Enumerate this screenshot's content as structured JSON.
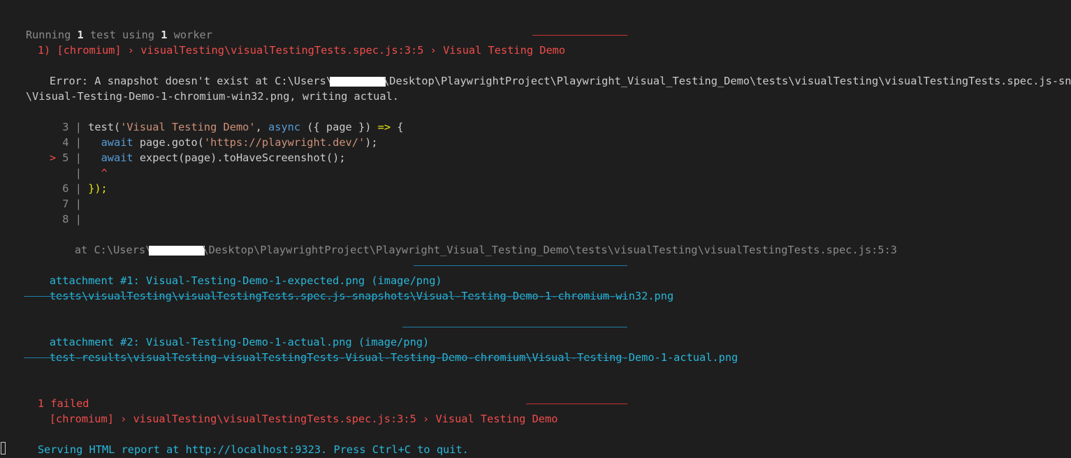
{
  "run": {
    "prefix": "Running ",
    "count1": "1",
    "mid": " test using ",
    "count2": "1",
    "suffix": " worker"
  },
  "test_header": {
    "index": "1) ",
    "browser": "[chromium]",
    "arrow1": " › ",
    "file": "visualTesting\\visualTestingTests.spec.js:3:5",
    "arrow2": " › ",
    "title": "Visual Testing Demo"
  },
  "error": {
    "line1_start": "Error: A snapshot doesn't exist at C:\\Users\\",
    "line1_end": "\\Desktop\\PlaywrightProject\\Playwright_Visual_Testing_Demo\\tests\\visualTesting\\visualTestingTests.spec.js-snapshots",
    "line2": "\\Visual-Testing-Demo-1-chromium-win32.png, writing actual."
  },
  "code": {
    "lines": [
      {
        "marker": "  ",
        "num": "3",
        "parts": {
          "a": "test(",
          "s": "'Visual Testing Demo'",
          "b": ", ",
          "k": "async",
          "c": " ({ page }) ",
          "y": "=>",
          "d": " {"
        }
      },
      {
        "marker": "  ",
        "num": "4",
        "parts": {
          "k": "await",
          "a": " page.goto(",
          "s": "'https://playwright.dev/'",
          "b": ");"
        }
      },
      {
        "marker": "> ",
        "num": "5",
        "parts": {
          "k": "await",
          "a": " expect(page).toHaveScreenshot();"
        }
      },
      {
        "marker": "  ",
        "num": "",
        "parts": {
          "caret": "^"
        }
      },
      {
        "marker": "  ",
        "num": "6",
        "parts": {
          "a": "});"
        }
      },
      {
        "marker": "  ",
        "num": "7",
        "parts": {}
      },
      {
        "marker": "  ",
        "num": "8",
        "parts": {}
      }
    ],
    "separator": "|"
  },
  "stack": {
    "start": "at C:\\Users\\",
    "end": "\\Desktop\\PlaywrightProject\\Playwright_Visual_Testing_Demo\\tests\\visualTesting\\visualTestingTests.spec.js:5:3"
  },
  "attachments": [
    {
      "header": "attachment #1: Visual-Testing-Demo-1-expected.png (image/png)",
      "path": "tests\\visualTesting\\visualTestingTests.spec.js-snapshots\\Visual-Testing-Demo-1-chromium-win32.png"
    },
    {
      "header": "attachment #2: Visual-Testing-Demo-1-actual.png (image/png)",
      "path": "test-results\\visualTesting-visualTestingTests-Visual-Testing-Demo-chromium\\Visual-Testing-Demo-1-actual.png"
    }
  ],
  "summary": {
    "failed": "1 failed",
    "entry_browser": "[chromium]",
    "entry_arrow1": " › ",
    "entry_file": "visualTesting\\visualTestingTests.spec.js:3:5",
    "entry_arrow2": " › ",
    "entry_title": "Visual Testing Demo"
  },
  "serve": "Serving HTML report at http://localhost:9323. Press Ctrl+C to quit.",
  "colors": {
    "background": "#1e1e1e",
    "error_red": "#f14c4c",
    "link_cyan": "#29b8db",
    "string": "#ce9178",
    "keyword": "#569cd6"
  }
}
